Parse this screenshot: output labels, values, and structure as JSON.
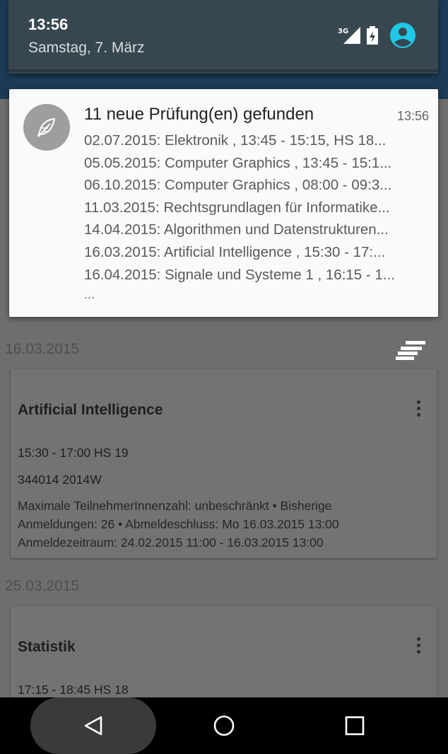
{
  "status": {
    "time": "13:56",
    "date": "Samstag, 7. März",
    "network": "3G",
    "icons": [
      "signal-icon",
      "battery-icon",
      "account-icon"
    ],
    "accent": "#1ec8e6"
  },
  "notification": {
    "title": "11 neue Prüfung(en) gefunden",
    "time": "13:56",
    "lines": [
      "02.07.2015: Elektronik , 13:45 - 15:15, HS 18...",
      "05.05.2015: Computer Graphics , 13:45 - 15:1...",
      "06.10.2015: Computer Graphics , 08:00 - 09:3...",
      "11.03.2015: Rechtsgrundlagen für Informatike...",
      "14.04.2015: Algorithmen und Datenstrukturen...",
      "16.03.2015: Artificial Intelligence , 15:30 - 17:...",
      "16.04.2015: Signale und Systeme 1 , 16:15 - 1..."
    ],
    "more": "...",
    "icon": "feather-icon"
  },
  "list": {
    "sections": [
      {
        "date": "16.03.2015",
        "card": {
          "title": "Artificial Intelligence",
          "time_room": "15:30 - 17:00 HS 19",
          "code": "344014 2014W",
          "detail": "Maximale TeilnehmerInnenzahl: unbeschränkt • Bisherige Anmeldungen: 26 • Abmeldeschluss: Mo 16.03.2015 13:00 Anmeldezeitraum: 24.02.2015 11:00 - 16.03.2015 13:00"
        }
      },
      {
        "date": "25.03.2015",
        "card": {
          "title": "Statistik",
          "time_room": "17:15 - 18:45 HS 18"
        }
      }
    ]
  },
  "navbar": {
    "buttons": [
      "back-icon",
      "home-icon",
      "recents-icon"
    ]
  }
}
